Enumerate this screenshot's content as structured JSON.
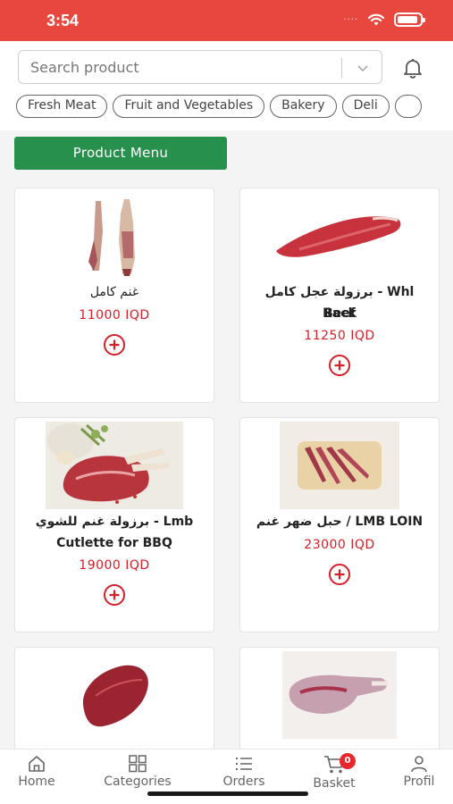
{
  "status_bar": {
    "time": "3:54",
    "battery_level": 0.9
  },
  "search": {
    "placeholder": "Search product"
  },
  "categories": [
    "Fresh Meat",
    "Fruit and Vegetables",
    "Bakery",
    "Deli"
  ],
  "menu_button": "Product Menu",
  "products": [
    {
      "name": "غنم كامل",
      "price": "11000 IQD"
    },
    {
      "name_line1": "برزولة عجل كامل - Whl Beef",
      "name_line2": "Rack",
      "price": "11250 IQD"
    },
    {
      "name_line1": "برزولة غنم للشوي - Lmb",
      "name_line2": "Cutlette for BBQ",
      "price": "19000 IQD"
    },
    {
      "name": "حبل ضهر غنم / LMB LOIN",
      "price": "23000 IQD"
    }
  ],
  "tabs": [
    {
      "label": "Home",
      "icon": "home-icon"
    },
    {
      "label": "Categories",
      "icon": "grid-icon"
    },
    {
      "label": "Orders",
      "icon": "list-icon"
    },
    {
      "label": "Basket",
      "icon": "cart-icon",
      "badge": "0"
    },
    {
      "label": "Profil",
      "icon": "person-icon"
    }
  ],
  "colors": {
    "header": "#e8473d",
    "menu_button": "#27904c",
    "price": "#d61f26"
  }
}
